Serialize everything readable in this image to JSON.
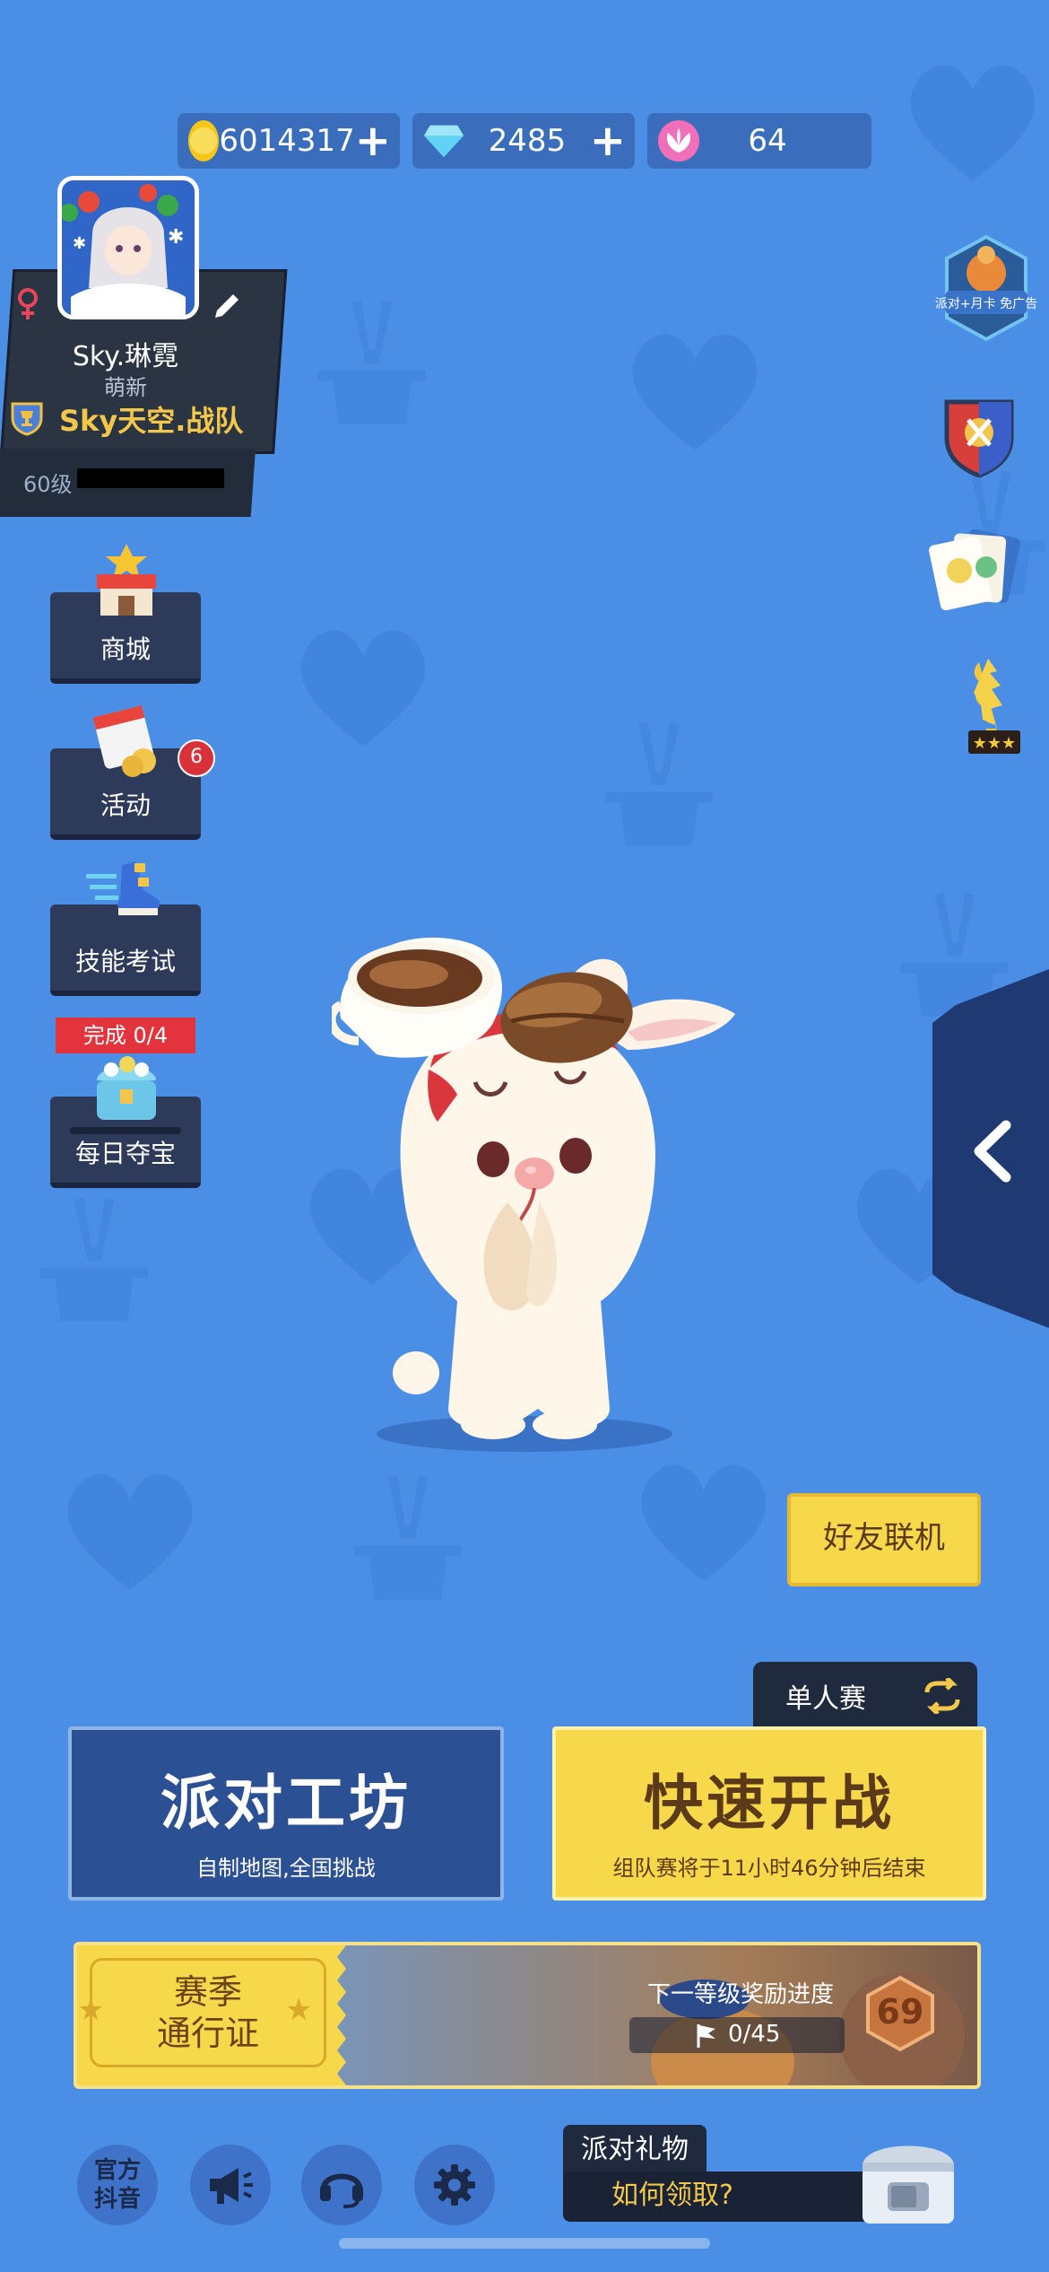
{
  "currency": {
    "coins": "6014317",
    "diamonds": "2485",
    "flowers": "64"
  },
  "profile": {
    "name": "Sky.琳霓",
    "title": "萌新",
    "team": "Sky天空.战队",
    "level": "60级"
  },
  "menu": {
    "shop": "商城",
    "events": "活动",
    "events_badge": "6",
    "skill_test": "技能考试",
    "daily_treasure": "每日夺宝",
    "daily_progress": "完成 0/4"
  },
  "right_panel": {
    "promo_label": "派对+月卡 免广告"
  },
  "buttons": {
    "friends": "好友联机",
    "mode": "单人赛",
    "workshop_title": "派对工坊",
    "workshop_sub": "自制地图,全国挑战",
    "quick_title": "快速开战",
    "quick_sub": "组队赛将于11小时46分钟后结束"
  },
  "season": {
    "pass_line1": "赛季",
    "pass_line2": "通行证",
    "next_reward": "下一等级奖励进度",
    "progress": "0/45",
    "level": "69"
  },
  "bottom": {
    "douyin_line1": "官方",
    "douyin_line2": "抖音",
    "gift_title": "派对礼物",
    "gift_sub": "如何领取?"
  },
  "colors": {
    "background": "#4a8ee6",
    "accent_yellow": "#f7d84a",
    "dark_panel": "#2b3443"
  }
}
